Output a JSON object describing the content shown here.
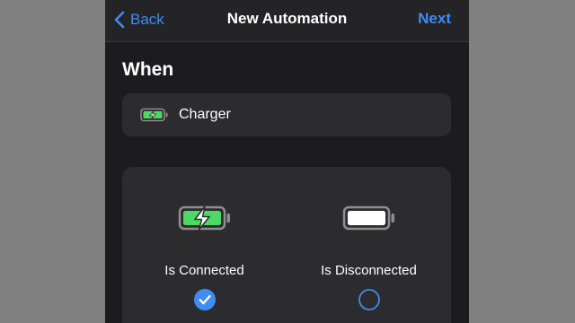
{
  "navbar": {
    "back_label": "Back",
    "title": "New Automation",
    "next_label": "Next"
  },
  "section": {
    "heading": "When"
  },
  "trigger": {
    "icon": "charging-battery-icon",
    "label": "Charger"
  },
  "options": [
    {
      "label": "Is Connected",
      "icon": "charging-battery-icon",
      "selected": true
    },
    {
      "label": "Is Disconnected",
      "icon": "full-battery-icon",
      "selected": false
    }
  ],
  "colors": {
    "accent": "#3f8cf2",
    "battery_charging_green": "#4cd964",
    "background": "#1c1c1e",
    "card": "#2c2c2e",
    "frame": "#808080"
  }
}
